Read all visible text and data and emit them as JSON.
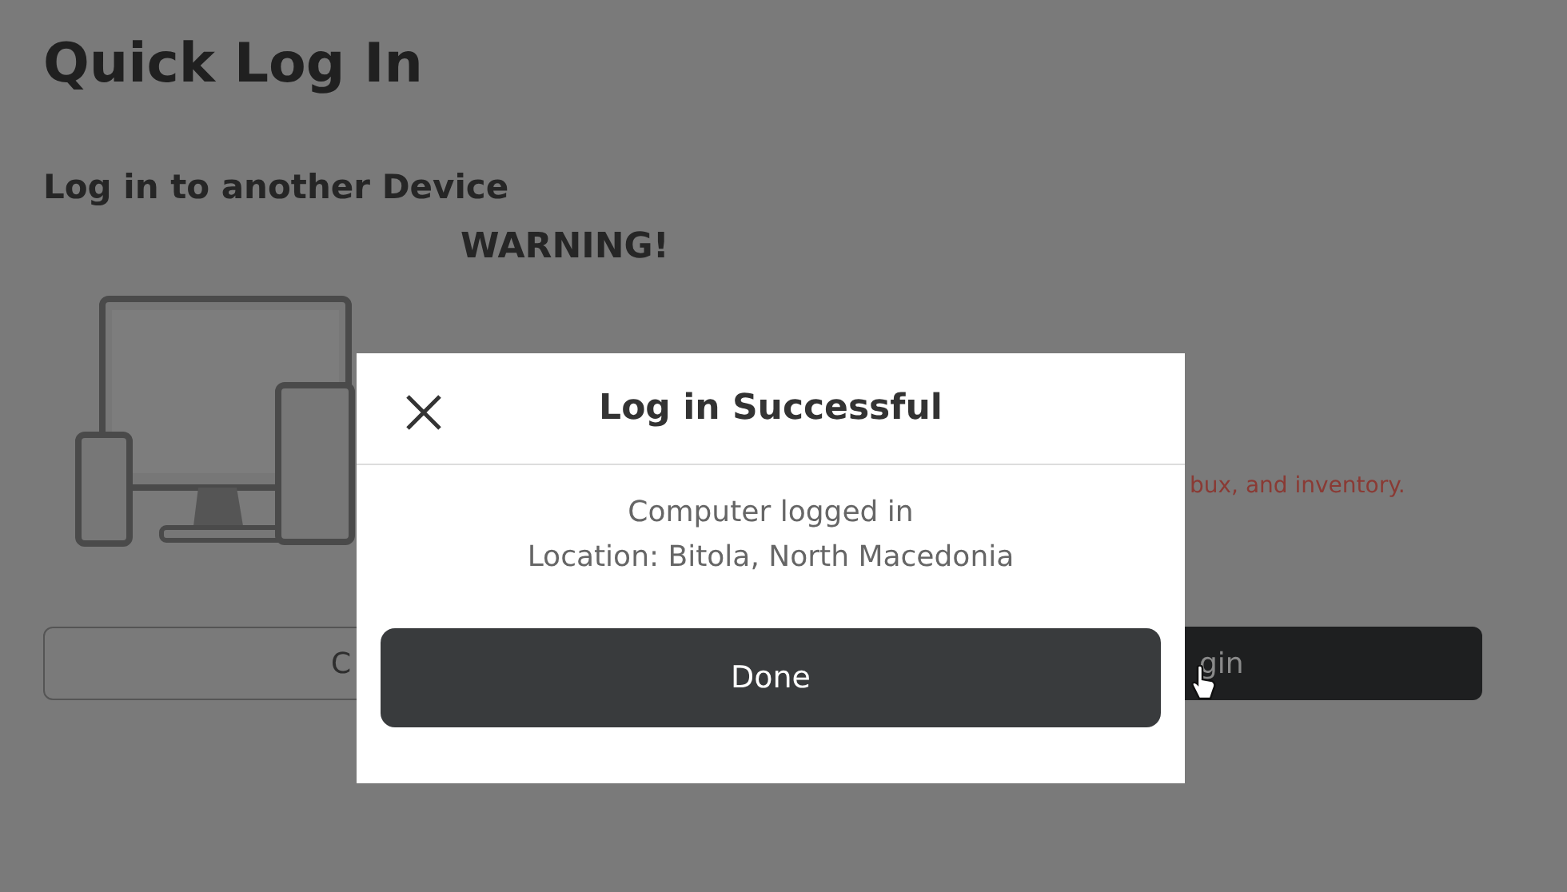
{
  "page": {
    "title": "Quick Log In",
    "subtitle": "Log in to another Device",
    "warning": "WARNING!",
    "warning_detail": "bux, and inventory.",
    "buttons": [
      {
        "label": "C",
        "kind": "outline"
      },
      {
        "label": "gin",
        "kind": "solid"
      }
    ]
  },
  "dialog": {
    "title": "Log in Successful",
    "lines": [
      "Computer logged in",
      "Location: Bitola, North Macedonia"
    ],
    "confirm": "Done"
  }
}
